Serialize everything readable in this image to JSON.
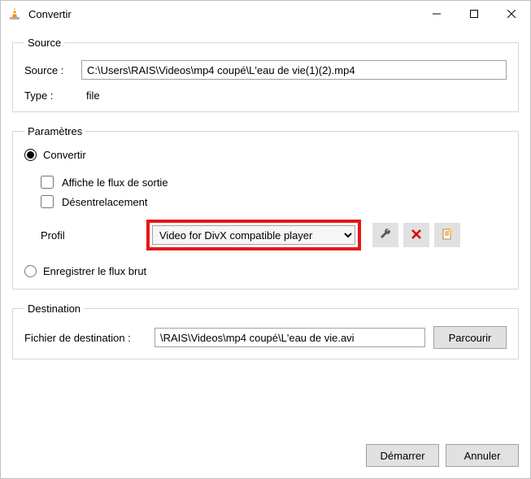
{
  "window": {
    "title": "Convertir"
  },
  "source_group": {
    "legend": "Source",
    "source_label": "Source :",
    "source_value": "C:\\Users\\RAIS\\Videos\\mp4 coupé\\L'eau de vie(1)(2).mp4",
    "type_label": "Type :",
    "type_value": "file"
  },
  "params_group": {
    "legend": "Paramètres",
    "convert_label": "Convertir",
    "show_output_label": "Affiche le flux de sortie",
    "deinterlace_label": "Désentrelacement",
    "profile_label": "Profil",
    "profile_selected": "Video for DivX compatible player",
    "raw_label": "Enregistrer le flux brut"
  },
  "dest_group": {
    "legend": "Destination",
    "dest_label": "Fichier de destination :",
    "dest_value": "\\RAIS\\Videos\\mp4 coupé\\L'eau de vie.avi",
    "browse_label": "Parcourir"
  },
  "buttons": {
    "start": "Démarrer",
    "cancel": "Annuler"
  }
}
